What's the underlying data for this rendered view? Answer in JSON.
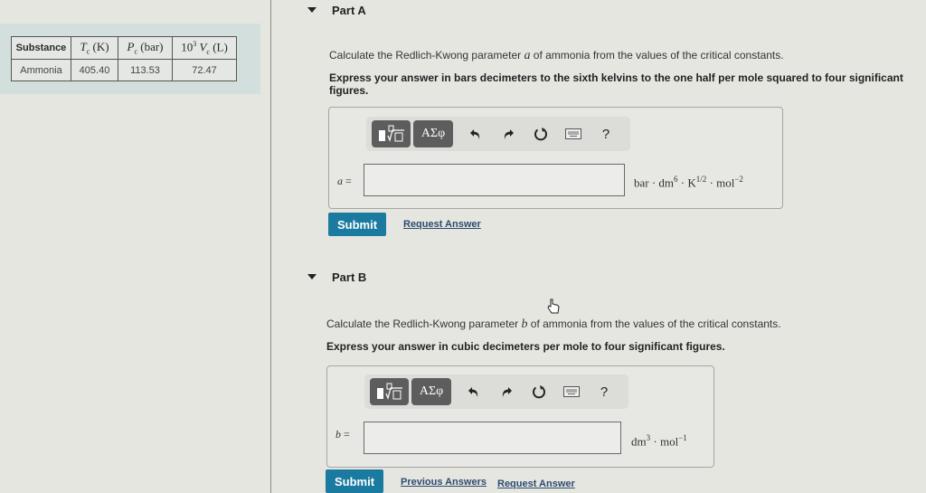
{
  "table": {
    "headers": [
      {
        "label": "Substance"
      },
      {
        "symbol": "T",
        "sub": "c",
        "unit": " (K)"
      },
      {
        "symbol": "P",
        "sub": "c",
        "unit": " (bar)"
      },
      {
        "prefix": "10",
        "sup": "3",
        "symbol": " V",
        "sub": "c",
        "unit": " (L)"
      }
    ],
    "rows": [
      [
        "Ammonia",
        "405.40",
        "113.53",
        "72.47"
      ]
    ]
  },
  "partA": {
    "title": "Part A",
    "question_pre": "Calculate the Redlich-Kwong parameter ",
    "question_var": "a",
    "question_post": " of ammonia from the values of the critical constants.",
    "instruction_line1": "Express your answer in bars decimeters to the sixth kelvins to the one half per mole squared to four significant",
    "instruction_line2": "figures.",
    "variable": "a",
    "equals": " =",
    "input_value": "",
    "units": {
      "u1": "bar · dm",
      "s1": "6",
      "u2": " · K",
      "s2": "1/2",
      "u3": " · mol",
      "s3": "−2"
    },
    "toolbar": {
      "greek_label": "ΑΣφ",
      "help_label": "?"
    },
    "submit_label": "Submit",
    "request_answer_label": "Request Answer"
  },
  "partB": {
    "title": "Part B",
    "question_pre": "Calculate the Redlich-Kwong parameter ",
    "question_var": "b",
    "question_post": " of ammonia from the values of the critical constants.",
    "instruction": "Express your answer in cubic decimeters per mole to four significant figures.",
    "variable": "b",
    "equals": " =",
    "input_value": "",
    "units": {
      "u1": "dm",
      "s1": "3",
      "u2": " · mol",
      "s2": "−1"
    },
    "toolbar": {
      "greek_label": "ΑΣφ",
      "help_label": "?"
    },
    "submit_label": "Submit",
    "previous_answers_label": "Previous Answers",
    "request_answer_label": "Request Answer"
  },
  "colors": {
    "submit": "#1b7aa0",
    "link": "#2c4b6e",
    "toolbar_button": "#5d5d5d"
  }
}
